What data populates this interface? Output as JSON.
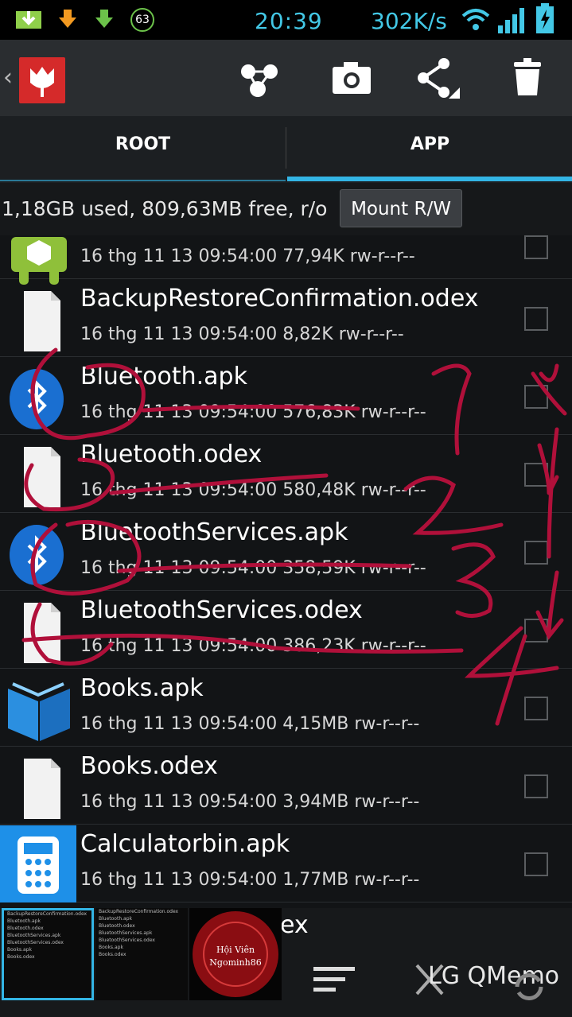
{
  "status_bar": {
    "time": "20:39",
    "speed": "302K/s",
    "badge": "63"
  },
  "tabs": [
    {
      "label": "ROOT"
    },
    {
      "label": "APP"
    }
  ],
  "info": {
    "text": "1,18GB used, 809,63MB free, r/o",
    "mount_label": "Mount R/W"
  },
  "files": [
    {
      "name": "",
      "meta": "16 thg 11 13 09:54:00  77,94K  rw-r--r--",
      "icon": "android-package-icon"
    },
    {
      "name": "BackupRestoreConfirmation.odex",
      "meta": "16 thg 11 13 09:54:00  8,82K  rw-r--r--",
      "icon": "file-icon"
    },
    {
      "name": "Bluetooth.apk",
      "meta": "16 thg 11 13 09:54:00  576,83K  rw-r--r--",
      "icon": "bluetooth-icon"
    },
    {
      "name": "Bluetooth.odex",
      "meta": "16 thg 11 13 09:54:00  580,48K  rw-r--r--",
      "icon": "file-icon"
    },
    {
      "name": "BluetoothServices.apk",
      "meta": "16 thg 11 13 09:54:00  358,59K  rw-r--r--",
      "icon": "bluetooth-icon"
    },
    {
      "name": "BluetoothServices.odex",
      "meta": "16 thg 11 13 09:54:00  386,23K  rw-r--r--",
      "icon": "file-icon"
    },
    {
      "name": "Books.apk",
      "meta": "16 thg 11 13 09:54:00  4,15MB  rw-r--r--",
      "icon": "books-icon"
    },
    {
      "name": "Books.odex",
      "meta": "16 thg 11 13 09:54:00  3,94MB  rw-r--r--",
      "icon": "file-icon"
    },
    {
      "name": "Calculatorbin.apk",
      "meta": "16 thg 11 13 09:54:00  1,77MB  rw-r--r--",
      "icon": "calculator-icon"
    }
  ],
  "bottom": {
    "partial_name": "ex",
    "qmemo_label": "LG QMemo",
    "thumb_lines": [
      "BackupRestoreConfirmation.odex",
      "Bluetooth.apk",
      "Bluetooth.odex",
      "BluetoothServices.apk",
      "BluetoothServices.odex",
      "Books.apk",
      "Books.odex"
    ],
    "watermark_text": "Hội Viên Ngominh86"
  },
  "annotations": [
    "1",
    "2",
    "3",
    "4"
  ],
  "colors": {
    "accent": "#33b5e5",
    "logo_red": "#d52a2a",
    "ink": "#b0103a"
  }
}
